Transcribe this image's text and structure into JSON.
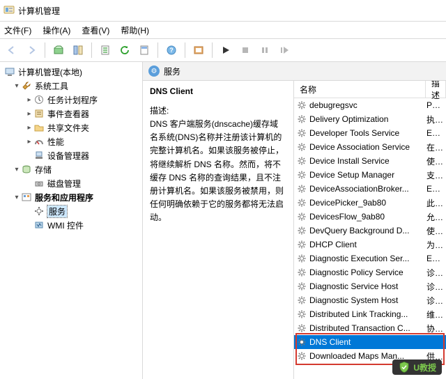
{
  "title": "计算机管理",
  "menu": {
    "file": "文件(F)",
    "action": "操作(A)",
    "view": "查看(V)",
    "help": "帮助(H)"
  },
  "tree": {
    "root": "计算机管理(本地)",
    "system_tools": "系统工具",
    "task_scheduler": "任务计划程序",
    "event_viewer": "事件查看器",
    "shared_folders": "共享文件夹",
    "performance": "性能",
    "device_manager": "设备管理器",
    "storage": "存储",
    "disk_mgmt": "磁盘管理",
    "services_apps": "服务和应用程序",
    "services": "服务",
    "wmi": "WMI 控件"
  },
  "main": {
    "header": "服务",
    "detail_title": "DNS Client",
    "desc_label": "描述:",
    "desc_body": "DNS 客户端服务(dnscache)缓存域名系统(DNS)名称并注册该计算机的完整计算机名。如果该服务被停止，将继续解析 DNS 名称。然而，将不缓存 DNS 名称的查询结果，且不注册计算机名。如果该服务被禁用，则任何明确依赖于它的服务都将无法启动。"
  },
  "columns": {
    "name": "名称",
    "desc": "描述"
  },
  "rows": [
    {
      "name": "debugregsvc",
      "desc": "Prov..."
    },
    {
      "name": "Delivery Optimization",
      "desc": "执行..."
    },
    {
      "name": "Developer Tools Service",
      "desc": "Ena..."
    },
    {
      "name": "Device Association Service",
      "desc": "在系..."
    },
    {
      "name": "Device Install Service",
      "desc": "使计..."
    },
    {
      "name": "Device Setup Manager",
      "desc": "支持..."
    },
    {
      "name": "DeviceAssociationBroker...",
      "desc": "Ena..."
    },
    {
      "name": "DevicePicker_9ab80",
      "desc": "此用..."
    },
    {
      "name": "DevicesFlow_9ab80",
      "desc": "允许..."
    },
    {
      "name": "DevQuery Background D...",
      "desc": "使应..."
    },
    {
      "name": "DHCP Client",
      "desc": "为此..."
    },
    {
      "name": "Diagnostic Execution Ser...",
      "desc": "Exec..."
    },
    {
      "name": "Diagnostic Policy Service",
      "desc": "诊断..."
    },
    {
      "name": "Diagnostic Service Host",
      "desc": "诊断..."
    },
    {
      "name": "Diagnostic System Host",
      "desc": "诊断..."
    },
    {
      "name": "Distributed Link Tracking...",
      "desc": "维护..."
    },
    {
      "name": "Distributed Transaction C...",
      "desc": "协调..."
    },
    {
      "name": "DNS Client",
      "desc": "",
      "selected": true
    },
    {
      "name": "Downloaded Maps Man...",
      "desc": "供应..."
    }
  ],
  "watermark": "U教授"
}
